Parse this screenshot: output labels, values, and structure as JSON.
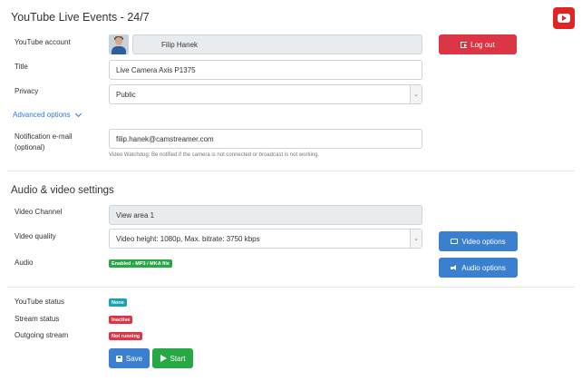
{
  "header": {
    "title": "YouTube Live Events - 24/7",
    "logo_icon": "youtube-icon",
    "brand_color": "#e02424"
  },
  "account": {
    "label": "YouTube account",
    "name": "Filip Hanek",
    "logout_label": "Log out",
    "logout_icon": "logout-icon"
  },
  "title_field": {
    "label": "Title",
    "value": "Live Camera Axis P1375"
  },
  "privacy": {
    "label": "Privacy",
    "value": "Public"
  },
  "advanced": {
    "label": "Advanced options"
  },
  "notification": {
    "label_line1": "Notification e-mail",
    "label_line2": "(optional)",
    "value": "filip.hanek@camstreamer.com",
    "help": "Video Watchdog: Be notified if the camera is not connected or broadcast is not working."
  },
  "av": {
    "section_title": "Audio & video settings",
    "channel_label": "Video Channel",
    "channel_value": "View area 1",
    "quality_label": "Video quality",
    "quality_value": "Video height: 1080p, Max. bitrate: 3750 kbps",
    "video_options_label": "Video options",
    "audio_label": "Audio",
    "audio_badge": "Enabled - MP3 / MKA file",
    "audio_options_label": "Audio options"
  },
  "status": {
    "youtube_label": "YouTube status",
    "youtube_value": "None",
    "stream_label": "Stream status",
    "stream_value": "Inactive",
    "outgoing_label": "Outgoing stream",
    "outgoing_value": "Not running"
  },
  "actions": {
    "save_label": "Save",
    "start_label": "Start"
  },
  "colors": {
    "danger": "#dc3545",
    "primary": "#3a7fd0",
    "success": "#28a745",
    "info": "#17a2b8",
    "link": "#2a7bd6"
  }
}
